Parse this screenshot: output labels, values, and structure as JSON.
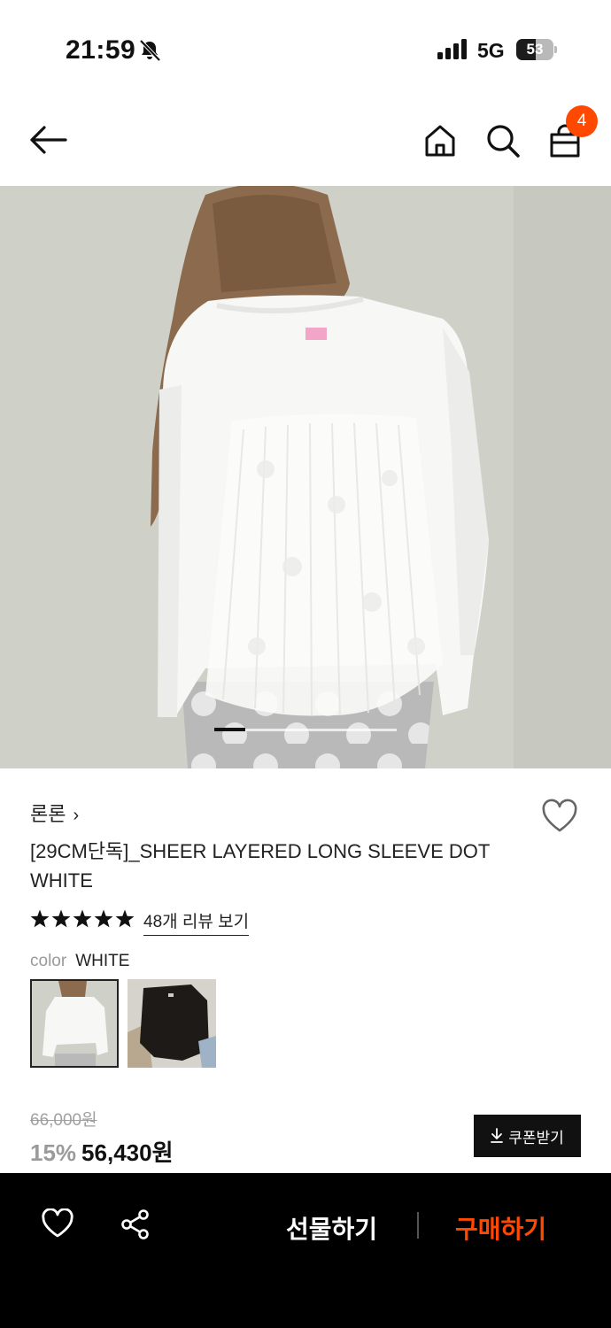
{
  "status_bar": {
    "time": "21:59",
    "network": "5G",
    "battery": "53",
    "battery_level": 0.53
  },
  "header": {
    "cart_count": "4",
    "icons": [
      "back-arrow-icon",
      "home-icon",
      "search-icon",
      "cart-bag-icon"
    ]
  },
  "carousel": {
    "progress": 0.17
  },
  "product": {
    "brand": "론론",
    "brand_chevron": "›",
    "title": "[29CM단독]_SHEER LAYERED LONG SLEEVE DOT WHITE",
    "rating_stars": 5,
    "review_link": "48개 리뷰 보기",
    "color_label": "color",
    "color_value": "WHITE",
    "swatches": [
      {
        "name": "white",
        "selected": true
      },
      {
        "name": "black",
        "selected": false
      }
    ]
  },
  "price": {
    "original": "66,000원",
    "discount": "15%",
    "sale": "56,430원",
    "coupon_label": "쿠폰받기",
    "coupon_icon": "download-icon"
  },
  "bottom_bar": {
    "gift_label": "선물하기",
    "buy_label": "구매하기",
    "colors": {
      "accent": "#ff4800",
      "background": "#000000"
    }
  }
}
